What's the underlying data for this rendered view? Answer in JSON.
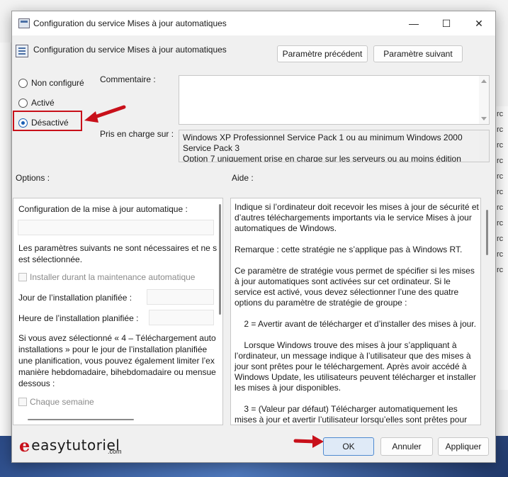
{
  "dialog": {
    "title": "Configuration du service Mises à jour automatiques",
    "header_title": "Configuration du service Mises à jour automatiques",
    "prev_button": "Paramètre précédent",
    "next_button": "Paramètre suivant"
  },
  "state": {
    "options": [
      {
        "label": "Non configuré",
        "checked": false
      },
      {
        "label": "Activé",
        "checked": false
      },
      {
        "label": "Désactivé",
        "checked": true
      }
    ]
  },
  "comment": {
    "label": "Commentaire :",
    "value": ""
  },
  "supported": {
    "label": "Pris en charge sur :",
    "lines": [
      "Windows XP Professionnel Service Pack 1 ou au minimum Windows 2000",
      "Service Pack 3",
      "Option 7 uniquement prise en charge sur les serveurs ou au moins édition"
    ]
  },
  "options_panel": {
    "label": "Options :",
    "configure_label": "Configuration de la mise à jour automatique :",
    "note_lines": [
      "Les paramètres suivants ne sont nécessaires et ne s",
      "est sélectionnée."
    ],
    "install_maintenance": "Installer durant la maintenance automatique",
    "install_day_label": "Jour de l’installation planifiée :",
    "install_time_label": "Heure de l’installation planifiée :",
    "info_lines": [
      "Si vous avez sélectionné « 4 – Téléchargement auto",
      "installations » pour le jour de l’installation planifiée",
      "une planification, vous pouvez également limiter l’ex",
      "manière hebdomadaire, bihebdomadaire ou mensue",
      "dessous :"
    ],
    "every_week": "Chaque semaine"
  },
  "help_panel": {
    "label": "Aide :",
    "paragraphs": [
      "Indique si l’ordinateur doit recevoir les mises à jour de sécurité et d’autres téléchargements importants via le service Mises à jour automatiques de Windows.",
      "Remarque : cette stratégie ne s’applique pas à Windows RT.",
      "Ce paramètre de stratégie vous permet de spécifier si les mises à jour automatiques sont activées sur cet ordinateur. Si le service est activé, vous devez sélectionner l’une des quatre options du paramètre de stratégie de groupe :",
      "    2 = Avertir avant de télécharger et d’installer des mises à jour.",
      "    Lorsque Windows trouve des mises à jour s’appliquant à l’ordinateur, un message indique à l’utilisateur que des mises à jour sont prêtes pour le téléchargement. Après avoir accédé à Windows Update, les utilisateurs peuvent télécharger et installer les mises à jour disponibles.",
      "    3 = (Valeur par défaut) Télécharger automatiquement les mises à jour et avertir l’utilisateur lorsqu’elles sont prêtes pour l’installation."
    ]
  },
  "footer": {
    "ok": "OK",
    "cancel": "Annuler",
    "apply": "Appliquer"
  },
  "watermark": {
    "brand": "easytutoriel",
    "suffix": ".com"
  },
  "colors": {
    "accent": "#1a5fb4",
    "annotation": "#c8101a"
  }
}
